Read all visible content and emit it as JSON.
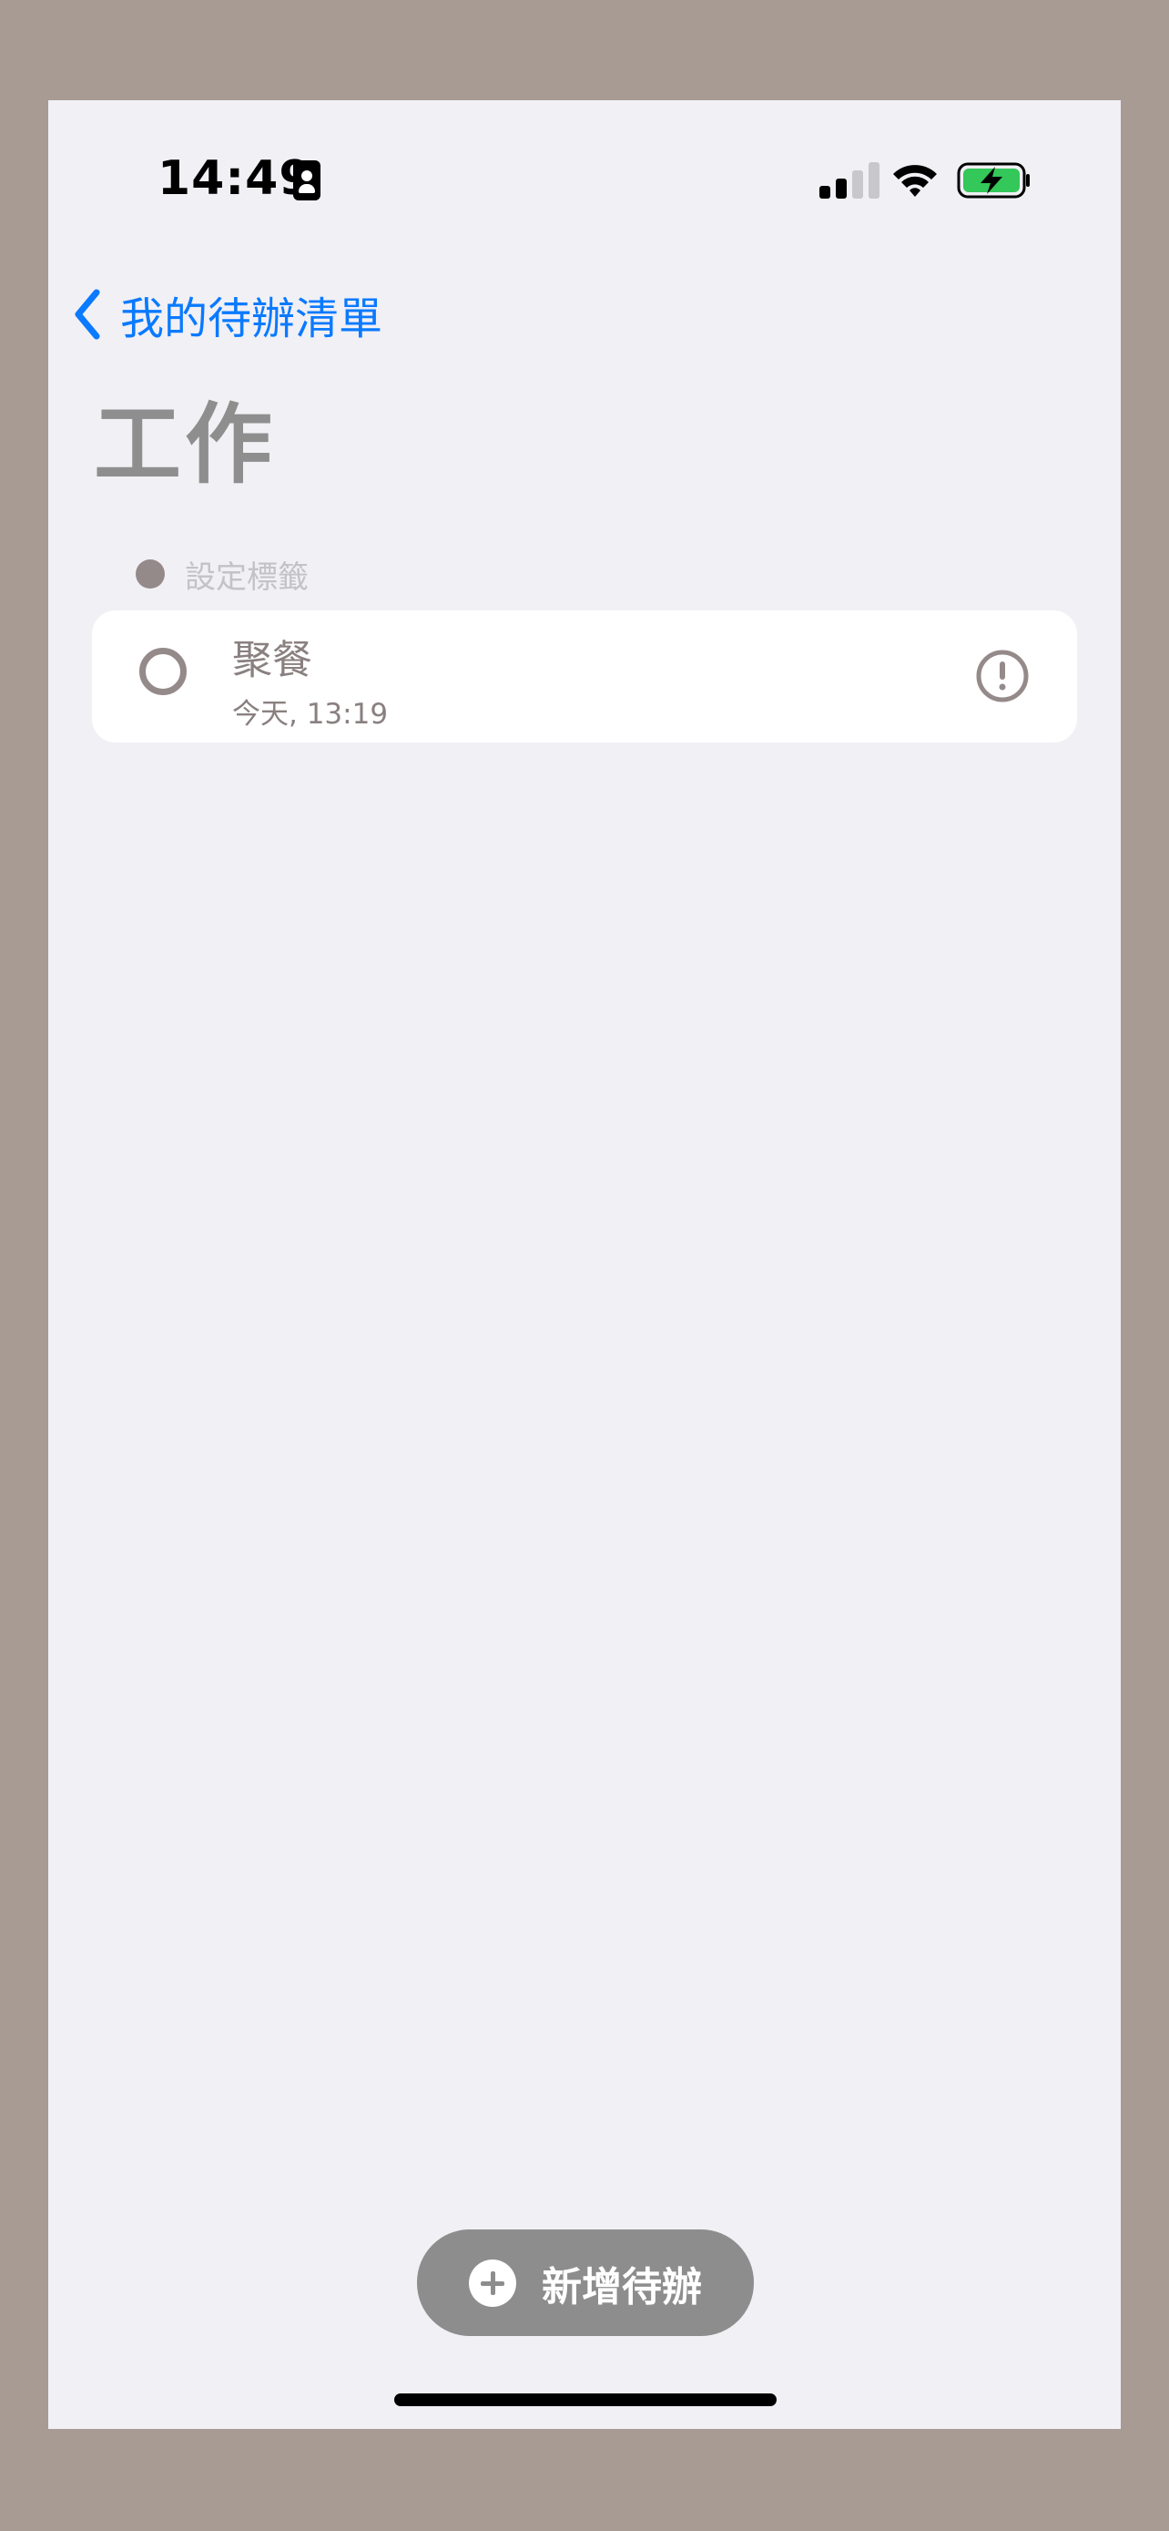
{
  "status_bar": {
    "time": "14:49",
    "id_icon": "id-badge-icon",
    "signal_icon": "cellular-signal-icon",
    "wifi_icon": "wifi-icon",
    "battery_icon": "battery-charging-icon"
  },
  "nav": {
    "back_icon": "chevron-left-icon",
    "back_label": "我的待辦清單"
  },
  "page": {
    "title": "工作"
  },
  "tag": {
    "label": "設定標籤"
  },
  "todos": [
    {
      "title": "聚餐",
      "subtitle": "今天, 13:19",
      "priority_icon": "exclamation-circle-icon"
    }
  ],
  "add_button": {
    "icon": "plus-circle-icon",
    "label": "新增待辦"
  },
  "colors": {
    "accent": "#0a7aff",
    "background": "#f1f0f5",
    "muted": "#958a8a",
    "button": "#8d8d8d",
    "battery": "#34c759"
  }
}
